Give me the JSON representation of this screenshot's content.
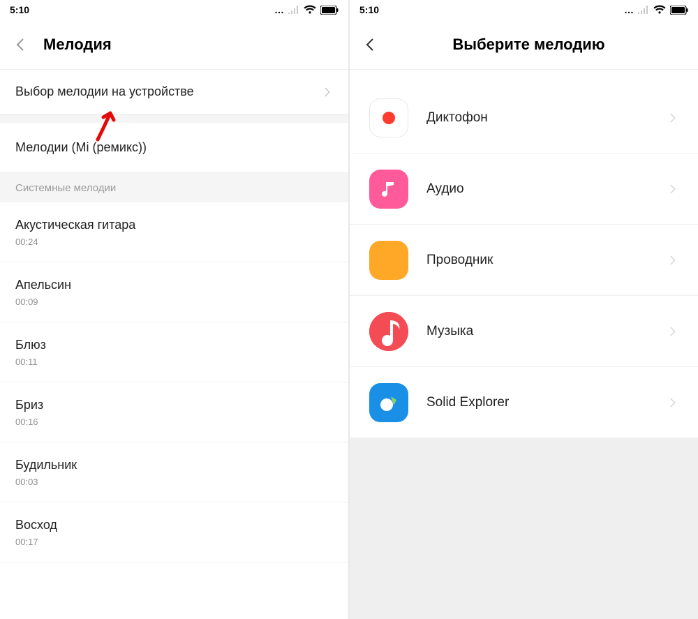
{
  "status": {
    "time": "5:10",
    "more_dots": "…"
  },
  "left": {
    "title": "Мелодия",
    "choose_on_device": "Выбор мелодии на устройстве",
    "mi_remix": "Мелодии (Mi (ремикс))",
    "section_system": "Системные мелодии",
    "tracks": [
      {
        "title": "Акустическая гитара",
        "duration": "00:24"
      },
      {
        "title": "Апельсин",
        "duration": "00:09"
      },
      {
        "title": "Блюз",
        "duration": "00:11"
      },
      {
        "title": "Бриз",
        "duration": "00:16"
      },
      {
        "title": "Будильник",
        "duration": "00:03"
      },
      {
        "title": "Восход",
        "duration": "00:17"
      }
    ]
  },
  "right": {
    "title": "Выберите мелодию",
    "apps": [
      {
        "label": "Диктофон",
        "icon": "record-icon",
        "bg": "#ffffff",
        "fg": "#ff3b30",
        "border": "#e8e8e8"
      },
      {
        "label": "Аудио",
        "icon": "music-note-icon",
        "bg": "#ff5a9a",
        "fg": "#ffffff",
        "border": ""
      },
      {
        "label": "Проводник",
        "icon": "folder-icon",
        "bg": "#ffa726",
        "fg": "#ffffff",
        "border": ""
      },
      {
        "label": "Музыка",
        "icon": "music-note-icon",
        "bg": "#f44c55",
        "fg": "#ffffff",
        "border": ""
      },
      {
        "label": "Solid Explorer",
        "icon": "solid-explorer-icon",
        "bg": "#1990e6",
        "fg": "#ffffff",
        "border": ""
      }
    ]
  }
}
